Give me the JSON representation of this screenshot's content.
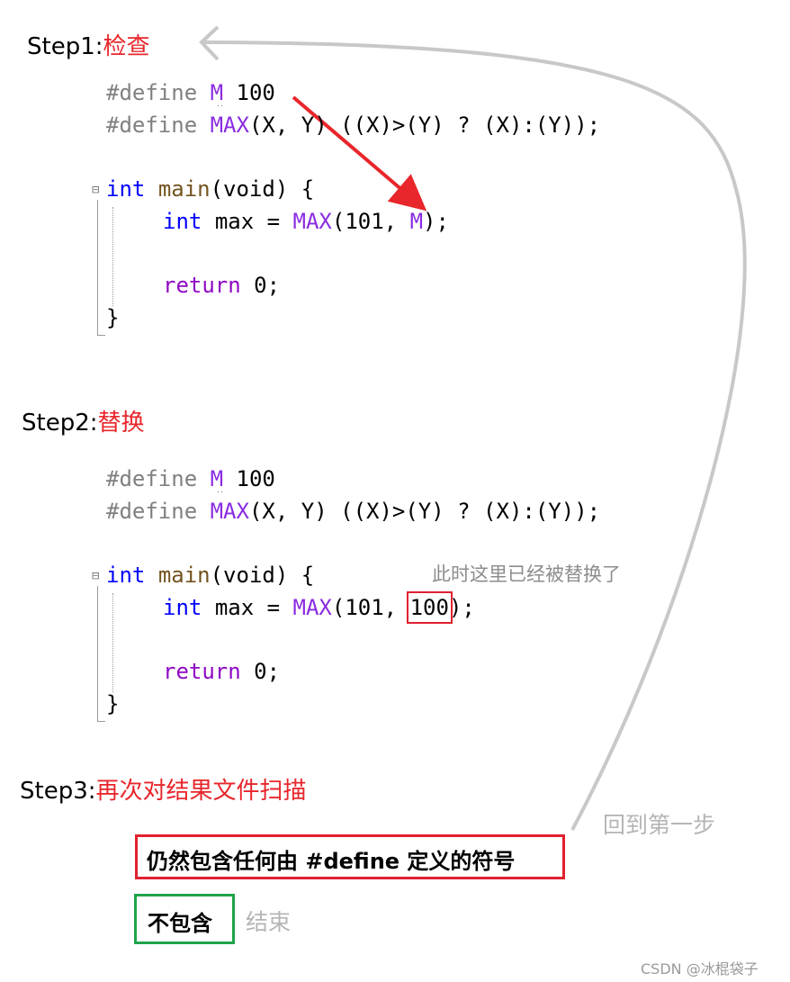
{
  "step1": {
    "label": "Step1:",
    "title": "检查"
  },
  "step2": {
    "label": "Step2:",
    "title": "替换"
  },
  "step3": {
    "label": "Step3:",
    "title": "再次对结果文件扫描"
  },
  "code1": {
    "define1": {
      "kw": "#define",
      "name": "M",
      "value": "100"
    },
    "define2": {
      "kw": "#define",
      "name": "MAX",
      "params": "(X, Y) ((X)>(Y) ? (X):(Y));"
    },
    "main_decl": {
      "type": "int",
      "name": "main",
      "args": "(void) {"
    },
    "stmt": {
      "type": "int",
      "var": "max =",
      "macro": "MAX",
      "args_open": "(101,",
      "arg2": "M",
      "close": ");"
    },
    "ret": {
      "kw": "return",
      "value": "0;"
    },
    "brace": "}"
  },
  "code2": {
    "define1": {
      "kw": "#define",
      "name": "M",
      "value": "100"
    },
    "define2": {
      "kw": "#define",
      "name": "MAX",
      "params": "(X, Y) ((X)>(Y) ? (X):(Y));"
    },
    "main_decl": {
      "type": "int",
      "name": "main",
      "args": "(void) {"
    },
    "stmt": {
      "type": "int",
      "var": "max =",
      "macro": "MAX",
      "args_open": "(101,",
      "arg2": "100",
      "close": ");"
    },
    "ret": {
      "kw": "return",
      "value": "0;"
    },
    "brace": "}"
  },
  "note_replaced": "此时这里已经被替换了",
  "loop_back_label": "回到第一步",
  "condition_contains": "仍然包含任何由 #define 定义的符号",
  "condition_not_contains": "不包含",
  "end_label": "结束",
  "watermark": "CSDN @冰棍袋子",
  "colors": {
    "title_red": "#e8262b",
    "box_red": "#e12030",
    "box_green": "#1fa34a",
    "arrow_red": "#e8262b",
    "loop_gray": "#c8c8c8"
  }
}
